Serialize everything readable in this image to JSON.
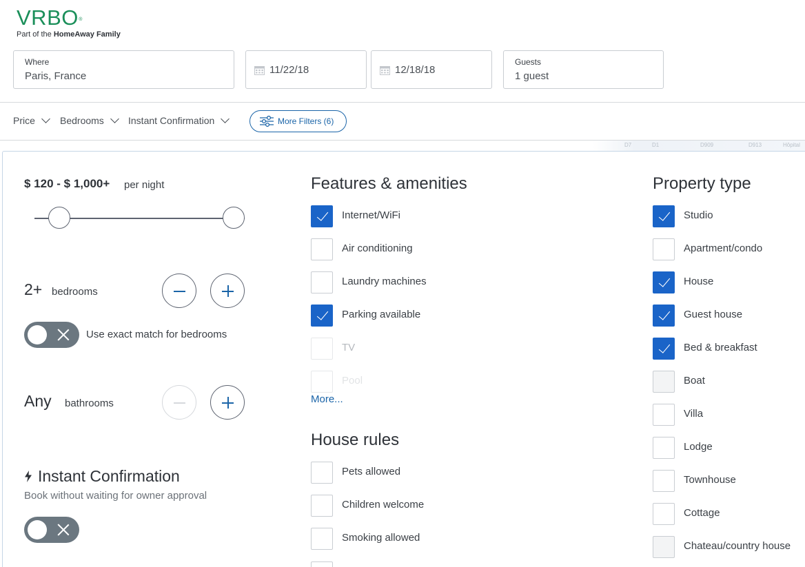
{
  "logo": {
    "word": "VRBO",
    "reg": "®",
    "tag_prefix": "Part of the ",
    "tag_brand": "HomeAway Family"
  },
  "search": {
    "where_label": "Where",
    "where_value": "Paris, France",
    "checkin": "11/22/18",
    "checkout": "12/18/18",
    "guests_label": "Guests",
    "guests_value": "1 guest"
  },
  "filters": {
    "price": "Price",
    "bedrooms": "Bedrooms",
    "instant": "Instant Confirmation",
    "more": "More Filters (6)"
  },
  "map_labels": [
    "D7",
    "D1",
    "D909",
    "D913",
    "Hôpital"
  ],
  "price": {
    "range": "$ 120 - $ 1,000+",
    "unit": "per night",
    "min_fraction": 0.0,
    "max_fraction": 1.0
  },
  "bedrooms": {
    "count": "2+",
    "label": "bedrooms",
    "exact_label": "Use exact match for bedrooms"
  },
  "bathrooms": {
    "count": "Any",
    "label": "bathrooms"
  },
  "instant": {
    "title": "Instant Confirmation",
    "subtitle": "Book without waiting for owner approval"
  },
  "features": {
    "title": "Features & amenities",
    "items": [
      {
        "label": "Internet/WiFi",
        "checked": true
      },
      {
        "label": "Air conditioning",
        "checked": false
      },
      {
        "label": "Laundry machines",
        "checked": false
      },
      {
        "label": "Parking available",
        "checked": true
      },
      {
        "label": "TV",
        "checked": false
      },
      {
        "label": "Pool",
        "checked": false
      }
    ],
    "more": "More..."
  },
  "house_rules": {
    "title": "House rules",
    "items": [
      {
        "label": "Pets allowed",
        "checked": false
      },
      {
        "label": "Children welcome",
        "checked": false
      },
      {
        "label": "Smoking allowed",
        "checked": false
      }
    ]
  },
  "property": {
    "title": "Property type",
    "items": [
      {
        "label": "Studio",
        "checked": true
      },
      {
        "label": "Apartment/condo",
        "checked": false
      },
      {
        "label": "House",
        "checked": true
      },
      {
        "label": "Guest house",
        "checked": true
      },
      {
        "label": "Bed & breakfast",
        "checked": true
      },
      {
        "label": "Boat",
        "checked": false
      },
      {
        "label": "Villa",
        "checked": false
      },
      {
        "label": "Lodge",
        "checked": false
      },
      {
        "label": "Townhouse",
        "checked": false
      },
      {
        "label": "Cottage",
        "checked": false
      },
      {
        "label": "Chateau/country house",
        "checked": false
      }
    ]
  },
  "colors": {
    "brand": "#1b8f5a",
    "accent": "#1a64c8",
    "link": "#1a64a8"
  }
}
